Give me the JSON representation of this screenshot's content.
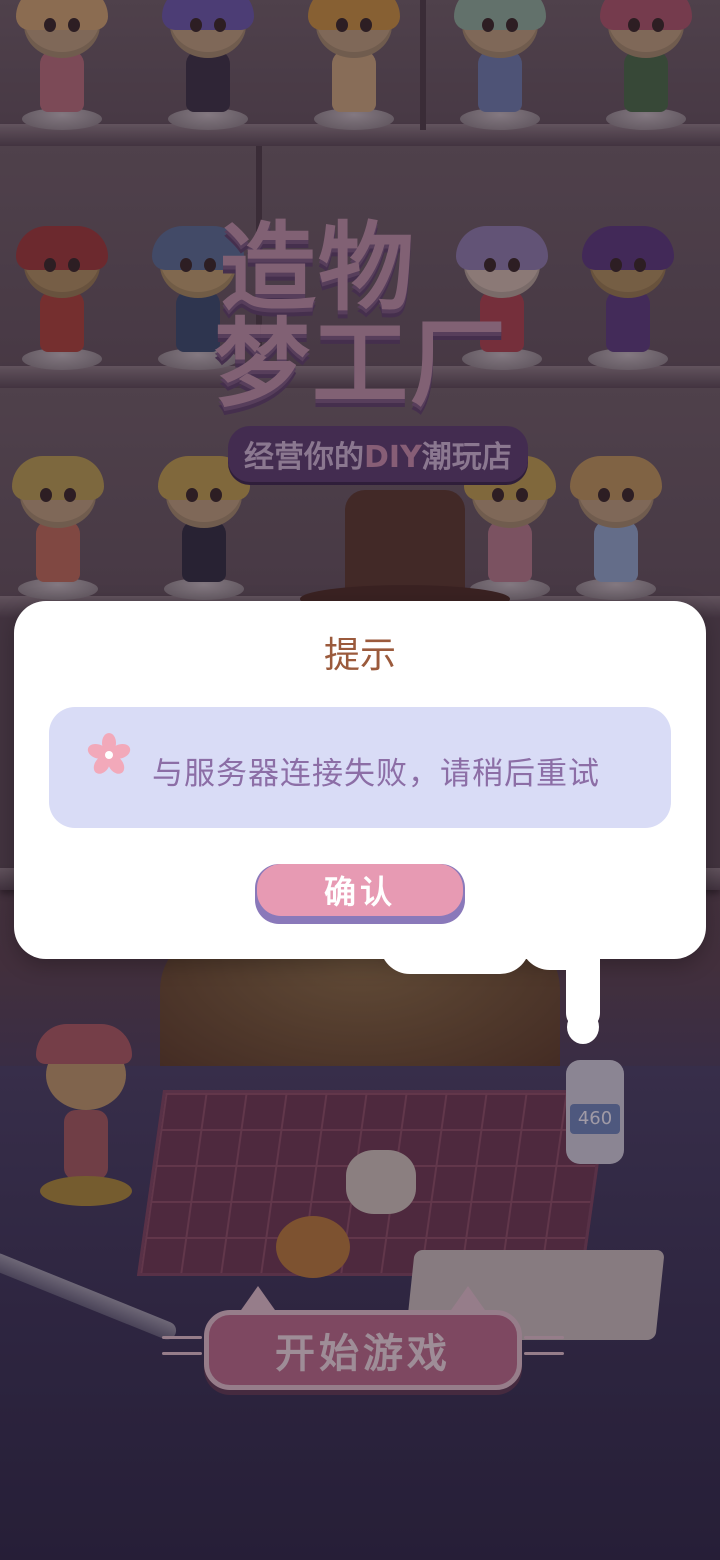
{
  "game": {
    "logo_line1": "造物",
    "logo_line2": "梦工厂",
    "logo_subtitle_pre": "经营你的",
    "logo_subtitle_diy": "DIY",
    "logo_subtitle_post": "潮玩店",
    "start_button_label": "开始游戏",
    "glue_label": "460"
  },
  "dialog": {
    "title": "提示",
    "message": "与服务器连接失败，请稍后重试",
    "confirm_label": "确认",
    "flower_icon": "sakura-flower-icon"
  },
  "colors": {
    "dialog_title": "#9b5a3c",
    "message_box": "#d9dcf6",
    "message_text": "#8c6ea6",
    "confirm_button": "#e79ab3"
  }
}
